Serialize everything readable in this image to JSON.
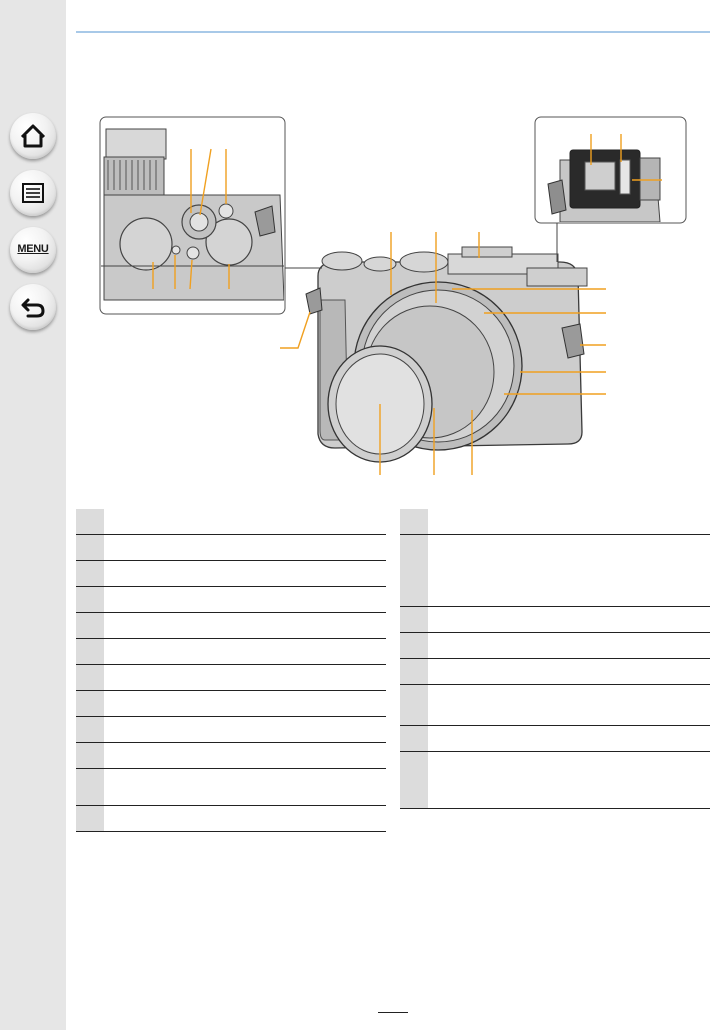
{
  "nav": {
    "home_icon": "home-icon",
    "contents_icon": "list-icon",
    "menu_label": "MENU",
    "back_icon": "return-arrow-icon"
  },
  "colors": {
    "sidebar": "#e6e6e6",
    "accent_rule": "#a8c9e8",
    "callout": "#f0a020",
    "table_number_cell": "#dcdcdc"
  },
  "left_table_rows": [
    {
      "num": "",
      "text": ""
    },
    {
      "num": "",
      "text": ""
    },
    {
      "num": "",
      "text": ""
    },
    {
      "num": "",
      "text": ""
    },
    {
      "num": "",
      "text": ""
    },
    {
      "num": "",
      "text": ""
    },
    {
      "num": "",
      "text": ""
    },
    {
      "num": "",
      "text": ""
    },
    {
      "num": "",
      "text": ""
    },
    {
      "num": "",
      "text": ""
    },
    {
      "num": "",
      "text": ""
    },
    {
      "num": "",
      "text": ""
    }
  ],
  "right_table_rows": [
    {
      "num": "",
      "text": ""
    },
    {
      "num": "",
      "text": ""
    },
    {
      "num": "",
      "text": ""
    },
    {
      "num": "",
      "text": ""
    },
    {
      "num": "",
      "text": ""
    },
    {
      "num": "",
      "text": ""
    },
    {
      "num": "",
      "text": ""
    },
    {
      "num": "",
      "text": ""
    }
  ]
}
